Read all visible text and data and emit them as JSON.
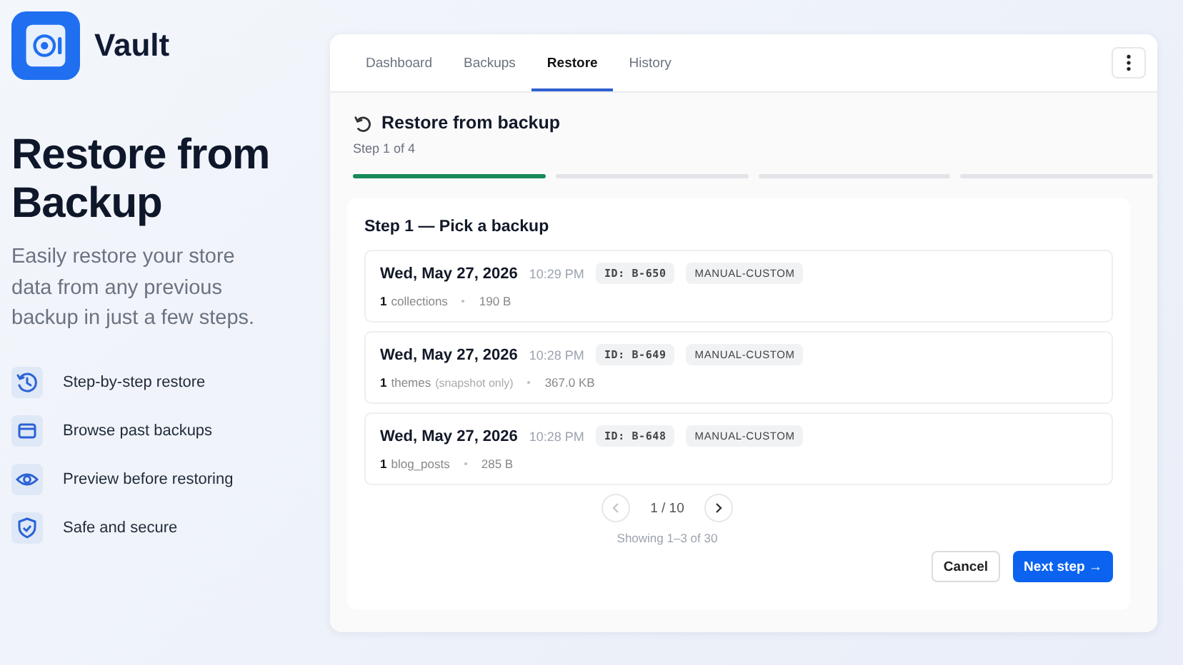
{
  "brand": {
    "name": "Vault"
  },
  "hero": {
    "title": "Restore from Backup",
    "subtitle": "Easily restore your store data from any previous backup in just a few steps."
  },
  "features": [
    {
      "label": "Step-by-step restore"
    },
    {
      "label": "Browse past backups"
    },
    {
      "label": "Preview before restoring"
    },
    {
      "label": "Safe and secure"
    }
  ],
  "tabs": [
    {
      "label": "Dashboard",
      "selected": false
    },
    {
      "label": "Backups",
      "selected": false
    },
    {
      "label": "Restore",
      "selected": true
    },
    {
      "label": "History",
      "selected": false
    }
  ],
  "panel": {
    "title": "Restore from backup",
    "step_text": "Step 1 of 4",
    "steps": [
      {
        "done": true
      },
      {
        "done": false
      },
      {
        "done": false
      },
      {
        "done": false
      }
    ],
    "section_title": "Step 1 — Pick a backup"
  },
  "backups": [
    {
      "date": "Wed, May 27, 2026",
      "time": "10:29 PM",
      "id": "ID: B-650",
      "tag": "MANUAL-CUSTOM",
      "count": "1",
      "type": "collections",
      "size": "190 B"
    },
    {
      "date": "Wed, May 27, 2026",
      "time": "10:28 PM",
      "id": "ID: B-649",
      "tag": "MANUAL-CUSTOM",
      "count": "1",
      "type": "themes",
      "note": "(snapshot only)",
      "size": "367.0 KB"
    },
    {
      "date": "Wed, May 27, 2026",
      "time": "10:28 PM",
      "id": "ID: B-648",
      "tag": "MANUAL-CUSTOM",
      "count": "1",
      "type": "blog_posts",
      "size": "285 B"
    }
  ],
  "pagination": {
    "page": "1 / 10",
    "prev_disabled": true,
    "next_disabled": false,
    "summary": "Showing 1–3 of 30"
  },
  "buttons": {
    "cancel": "Cancel",
    "next": "Next step →"
  }
}
